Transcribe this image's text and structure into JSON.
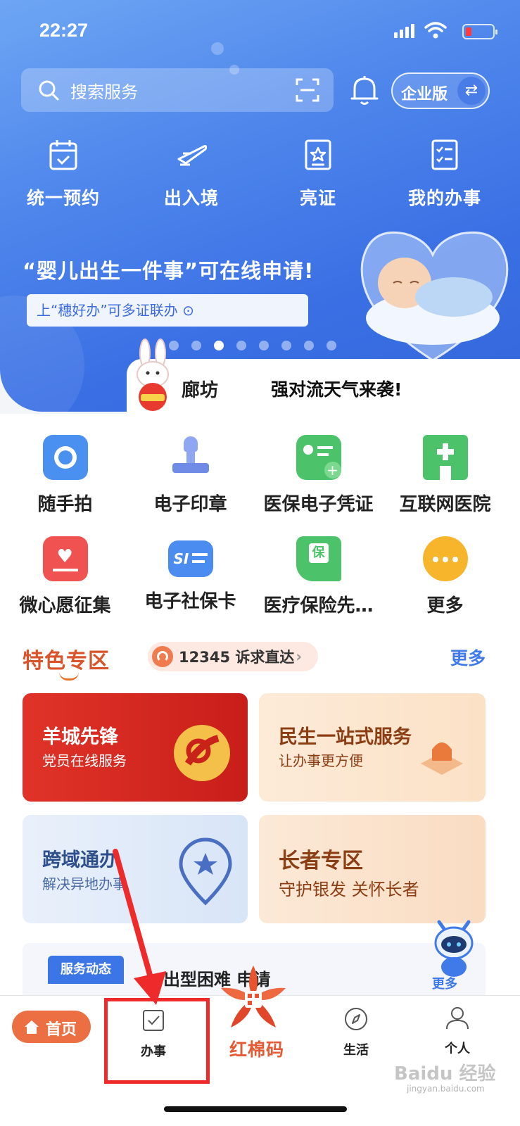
{
  "status_bar": {
    "time": "22:27"
  },
  "header": {
    "search_placeholder": "搜索服务",
    "enterprise_label": "企业版",
    "swap_icon": "⇄"
  },
  "quick_actions": [
    {
      "label": "统一预约",
      "icon": "calendar-check-icon"
    },
    {
      "label": "出入境",
      "icon": "airplane-icon"
    },
    {
      "label": "亮证",
      "icon": "id-star-icon"
    },
    {
      "label": "我的办事",
      "icon": "checklist-icon"
    }
  ],
  "banner": {
    "title": "“婴儿出生一件事”可在线申请!",
    "subtitle": "上“穗好办”可多证联办 ⊙",
    "page_count": 8,
    "active_page": 3
  },
  "news": {
    "city": "廊坊",
    "headline": "强对流天气来袭!"
  },
  "services": [
    {
      "label": "随手拍",
      "icon": "camera-icon",
      "color": "#4a90f0"
    },
    {
      "label": "电子印章",
      "icon": "stamp-icon",
      "color": "#6f8be6"
    },
    {
      "label": "医保电子凭证",
      "icon": "card-plus-icon",
      "color": "#4cc36a"
    },
    {
      "label": "互联网医院",
      "icon": "hospital-icon",
      "color": "#4cc36a"
    },
    {
      "label": "微心愿征集",
      "icon": "heart-card-icon",
      "color": "#f05252"
    },
    {
      "label": "电子社保卡",
      "icon": "si-card-icon",
      "color": "#4a8cf0"
    },
    {
      "label": "医疗保险先…",
      "icon": "insurance-hand-icon",
      "color": "#4cc36a"
    },
    {
      "label": "更多",
      "icon": "more-dots-icon",
      "color": "#f7b52b"
    }
  ],
  "featured": {
    "title": "特色专区",
    "hotline": "12345 诉求直达",
    "hotline_chevron": "›",
    "more": "更多",
    "cards": [
      {
        "title": "羊城先锋",
        "subtitle": "党员在线服务"
      },
      {
        "title": "民生一站式服务",
        "subtitle": "让办事更方便"
      },
      {
        "title": "跨域通办",
        "subtitle": "解决异地办事"
      },
      {
        "title": "长者专区",
        "subtitle": "守护银发 关怀长者"
      }
    ]
  },
  "dynamics": {
    "badge": "服务动态",
    "text": "出型困难  申请",
    "side_more": "更多"
  },
  "tabbar": {
    "home": "首页",
    "work": "办事",
    "center": "红棉码",
    "life": "生活",
    "personal": "个人"
  },
  "watermark": {
    "text": "Baidu 经验",
    "sub": "jingyan.baidu.com"
  },
  "colors": {
    "brand_blue": "#3f7ae8",
    "accent_orange": "#ec6f43",
    "highlight_red": "#ee2a2a"
  }
}
